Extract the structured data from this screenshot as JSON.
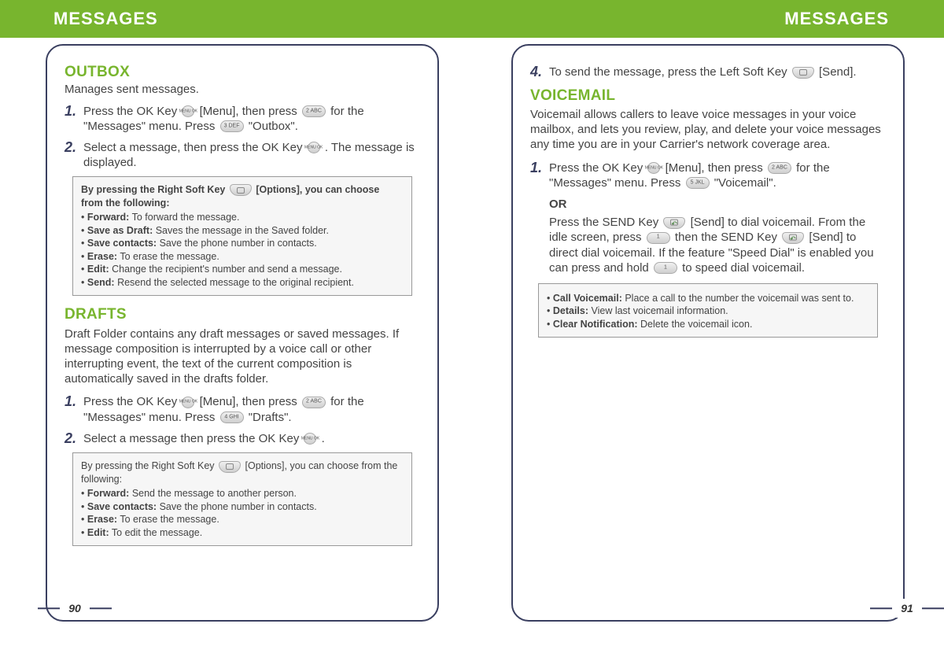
{
  "banner": {
    "left": "MESSAGES",
    "right": "MESSAGES"
  },
  "pagenum": {
    "left": "90",
    "right": "91"
  },
  "left": {
    "outbox": {
      "title": "OUTBOX",
      "subtitle": "Manages sent messages.",
      "steps": [
        {
          "n": "1.",
          "a": "Press the OK Key ",
          "k1_label": "MENU OK",
          "b": " [Menu], then press ",
          "k2_label": "2 ABC",
          "c": " for the \"Messages\" menu.  Press ",
          "k3_label": "3 DEF",
          "d": " \"Outbox\"."
        },
        {
          "n": "2.",
          "a": "Select a message, then press the OK Key ",
          "k1_label": "MENU OK",
          "b": " .  The message is displayed."
        }
      ],
      "box": {
        "lead_a": "By pressing the Right Soft Key ",
        "lead_b": " [Options], you can choose from the following:",
        "items": [
          {
            "label": "Forward:",
            "desc": " To forward the message."
          },
          {
            "label": "Save as Draft:",
            "desc": " Saves the message in the Saved folder."
          },
          {
            "label": "Save contacts:",
            "desc": " Save the phone number in contacts."
          },
          {
            "label": "Erase:",
            "desc": " To erase the message."
          },
          {
            "label": "Edit:",
            "desc": " Change the recipient's number and send a message."
          },
          {
            "label": "Send:",
            "desc": " Resend the selected message to the original recipient."
          }
        ]
      }
    },
    "drafts": {
      "title": "DRAFTS",
      "para": "Draft Folder contains any draft messages or saved messages. If message composition is interrupted by a voice call or other interrupting event, the text of the current composition is automatically saved in the drafts folder.",
      "steps": [
        {
          "n": "1.",
          "a": "Press the OK Key ",
          "k1_label": "MENU OK",
          "b": " [Menu], then press ",
          "k2_label": "2 ABC",
          "c": " for the \"Messages\" menu.  Press ",
          "k3_label": "4 GHI",
          "d": " \"Drafts\"."
        },
        {
          "n": "2.",
          "a": "Select a message then press the OK Key ",
          "k1_label": "MENU OK",
          "b": " ."
        }
      ],
      "box": {
        "lead_a": "By pressing the Right Soft Key ",
        "lead_b": " [Options], you can choose from the following:",
        "items": [
          {
            "label": "Forward:",
            "desc": " Send the message to another person."
          },
          {
            "label": "Save contacts:",
            "desc": " Save the phone number in contacts."
          },
          {
            "label": "Erase:",
            "desc": " To erase the message."
          },
          {
            "label": "Edit:",
            "desc": " To edit the message."
          }
        ]
      }
    }
  },
  "right": {
    "step4": {
      "n": "4.",
      "a": "To send the message, press the Left Soft Key ",
      "b": " [Send]."
    },
    "voicemail": {
      "title": "VOICEMAIL",
      "para": "Voicemail allows callers to leave voice messages in your voice mailbox, and lets you review, play, and delete your voice messages any time you are in your Carrier's network coverage area.",
      "step1": {
        "n": "1.",
        "a": "Press the OK Key ",
        "k1_label": "MENU OK",
        "b": " [Menu], then press ",
        "k2_label": "2 ABC",
        "c": " for the \"Messages\" menu.  Press ",
        "k3_label": "5 JKL",
        "d": " \"Voicemail\"."
      },
      "or_label": "OR",
      "or_text": {
        "a": "Press the SEND Key ",
        "b": " [Send] to dial voicemail.  From the idle screen, press ",
        "k1_label": "1",
        "c": " then the SEND Key ",
        "d": " [Send] to direct dial voicemail.  If the feature \"Speed Dial\" is enabled you can press and hold ",
        "k2_label": "1",
        "e": " to speed dial voicemail."
      },
      "box": {
        "items": [
          {
            "label": "Call Voicemail:",
            "desc": " Place a call to the number the voicemail was sent to."
          },
          {
            "label": "Details:",
            "desc": " View last voicemail information."
          },
          {
            "label": "Clear Notification:",
            "desc": " Delete the voicemail icon."
          }
        ]
      }
    }
  }
}
